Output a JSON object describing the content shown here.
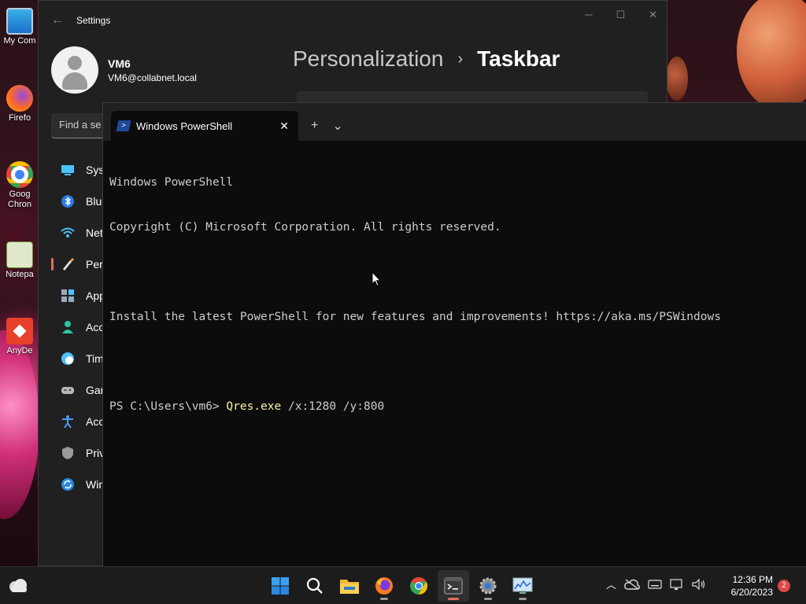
{
  "desktop": {
    "icons": [
      {
        "label": "My Com"
      },
      {
        "label": "Firefo"
      },
      {
        "label": "Goog\nChron"
      },
      {
        "label": "Notepa"
      },
      {
        "label": "AnyDe"
      }
    ]
  },
  "settings": {
    "title": "Settings",
    "user_name": "VM6",
    "user_email": "VM6@collabnet.local",
    "search_placeholder": "Find a se",
    "breadcrumb_parent": "Personalization",
    "breadcrumb_separator": "›",
    "breadcrumb_current": "Taskbar",
    "nav": [
      {
        "label": "Syst",
        "icon": "system-icon"
      },
      {
        "label": "Blue",
        "icon": "bluetooth-icon"
      },
      {
        "label": "Netw",
        "icon": "network-icon"
      },
      {
        "label": "Pers",
        "icon": "personalization-brush-icon",
        "active": true
      },
      {
        "label": "App",
        "icon": "apps-icon"
      },
      {
        "label": "Acco",
        "icon": "accounts-icon"
      },
      {
        "label": "Tim",
        "icon": "time-language-icon"
      },
      {
        "label": "Gar",
        "icon": "gaming-icon"
      },
      {
        "label": "Acc",
        "icon": "accessibility-icon"
      },
      {
        "label": "Priv",
        "icon": "privacy-shield-icon"
      },
      {
        "label": "Win",
        "icon": "windows-update-icon"
      }
    ]
  },
  "terminal": {
    "tab_title": "Windows PowerShell",
    "tab_close": "✕",
    "new_tab": "+",
    "dropdown": "⌄",
    "lines": {
      "line1": "Windows PowerShell",
      "line2": "Copyright (C) Microsoft Corporation. All rights reserved.",
      "line3": "",
      "line4": "Install the latest PowerShell for new features and improvements! https://aka.ms/PSWindows",
      "line5": "",
      "prompt": "PS C:\\Users\\vm6> ",
      "command": "Qres.exe",
      "args": " /x:1280 /y:800"
    }
  },
  "taskbar": {
    "apps": [
      {
        "name": "start",
        "icon": "windows-start-icon"
      },
      {
        "name": "search",
        "icon": "search-icon"
      },
      {
        "name": "file-explorer",
        "icon": "folder-icon"
      },
      {
        "name": "firefox",
        "icon": "firefox-icon"
      },
      {
        "name": "chrome",
        "icon": "chrome-icon"
      },
      {
        "name": "terminal",
        "icon": "terminal-icon",
        "active": true
      },
      {
        "name": "settings",
        "icon": "settings-gear-icon"
      },
      {
        "name": "resource-monitor",
        "icon": "monitor-chart-icon"
      }
    ],
    "time": "12:36 PM",
    "date": "6/20/2023",
    "notification_count": "2"
  },
  "colors": {
    "accent": "#e86a5a",
    "terminal_bg": "#0c0c0c",
    "command_highlight": "#f9f1a5"
  }
}
